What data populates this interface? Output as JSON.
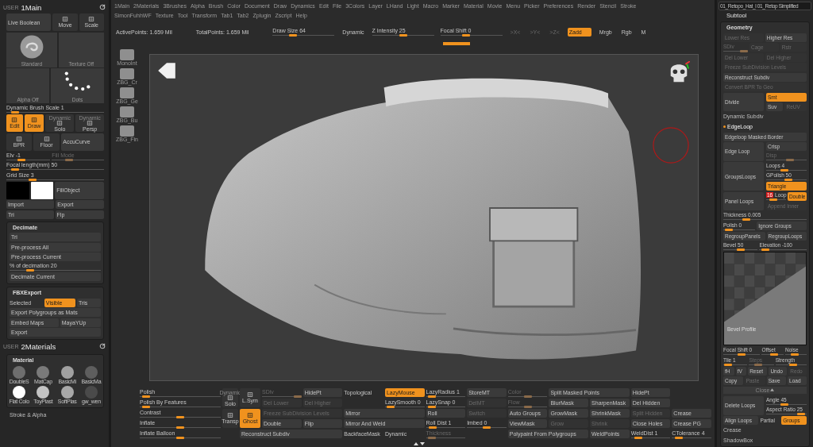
{
  "left_panel": {
    "sections": [
      {
        "kind": "tab",
        "user": "USER",
        "title": "1Main"
      },
      {
        "kind": "rows",
        "rows": [
          {
            "items": [
              {
                "kind": "button",
                "label": "Live Boolean",
                "on": false,
                "disabled": false
              },
              {
                "kind": "icon",
                "label": "Move",
                "on": false
              },
              {
                "kind": "icon",
                "label": "Scale",
                "on": false
              }
            ]
          },
          {
            "items": [
              {
                "kind": "brush",
                "label": "Standard"
              },
              {
                "kind": "texture",
                "label": "Texture Off"
              }
            ]
          },
          {
            "items": [
              {
                "kind": "alpha",
                "label": "Alpha Off"
              },
              {
                "kind": "stroke",
                "label": "Dots"
              }
            ]
          },
          {
            "items": [
              {
                "kind": "slider",
                "label": "Dynamic Brush Scale",
                "value": "1",
                "level": 0.05,
                "disabled": false
              }
            ]
          },
          {
            "items": [
              {
                "kind": "icon",
                "label": "Edit",
                "on": true
              },
              {
                "kind": "icon",
                "label": "Draw",
                "on": true
              },
              {
                "kind": "icon",
                "caption": "Dynamic",
                "label": "Solo",
                "on": false
              },
              {
                "kind": "icon",
                "caption": "Dynamic",
                "label": "Persp",
                "on": false
              }
            ]
          },
          {
            "items": [
              {
                "kind": "icon",
                "label": "BPR",
                "on": false
              },
              {
                "kind": "icon",
                "label": "Floor",
                "on": false
              },
              {
                "kind": "button",
                "label": "AccuCurve",
                "on": false,
                "disabled": false
              }
            ]
          },
          {
            "items": [
              {
                "kind": "slider",
                "label": "Elv",
                "value": "-1",
                "level": 0.3,
                "disabled": false
              },
              {
                "kind": "slider",
                "label": "Fill Mode",
                "level": 0.3,
                "disabled": true
              }
            ]
          },
          {
            "items": [
              {
                "kind": "slider",
                "label": "Focal length(mm)",
                "value": "50",
                "level": 0.05,
                "disabled": false
              }
            ]
          },
          {
            "items": [
              {
                "kind": "slider",
                "label": "Grid Size",
                "value": "3",
                "level": 0.25,
                "disabled": false
              }
            ]
          },
          {
            "items": [
              {
                "kind": "swatch",
                "color": "#000000"
              },
              {
                "kind": "swatch",
                "color": "#ffffff"
              },
              {
                "kind": "button",
                "label": "FillObject",
                "on": false,
                "disabled": false
              }
            ]
          },
          {
            "items": [
              {
                "kind": "button",
                "label": "Import",
                "on": false,
                "disabled": false
              },
              {
                "kind": "button",
                "label": "Export",
                "on": false,
                "disabled": false
              }
            ]
          },
          {
            "items": [
              {
                "kind": "button",
                "label": "Tri",
                "on": false,
                "disabled": false
              },
              {
                "kind": "button",
                "label": "Flp",
                "on": false,
                "disabled": false
              }
            ]
          }
        ]
      },
      {
        "kind": "panel",
        "title": "Decimate",
        "rows": [
          {
            "items": [
              {
                "kind": "button",
                "label": "Tri",
                "on": false,
                "disabled": false
              }
            ]
          },
          {
            "items": [
              {
                "kind": "button",
                "label": "Pre-process All",
                "on": false,
                "disabled": false
              }
            ]
          },
          {
            "items": [
              {
                "kind": "button",
                "label": "Pre-process Current",
                "on": false,
                "disabled": false
              }
            ]
          },
          {
            "items": [
              {
                "kind": "slider",
                "label": "% of decimation",
                "value": "20",
                "level": 0.2,
                "disabled": false
              }
            ]
          },
          {
            "items": [
              {
                "kind": "button",
                "label": "Decimate Current",
                "on": false,
                "disabled": false
              }
            ]
          }
        ]
      },
      {
        "kind": "panel",
        "title": "FBXExport",
        "rows": [
          {
            "items": [
              {
                "kind": "text",
                "label": "Selected"
              },
              {
                "kind": "button",
                "label": "Visible",
                "on": true,
                "disabled": false
              },
              {
                "kind": "button",
                "label": "Tris",
                "on": false,
                "disabled": false
              }
            ]
          },
          {
            "items": [
              {
                "kind": "button",
                "label": "Export Polygroups as Mats",
                "on": false,
                "disabled": false
              }
            ]
          },
          {
            "items": [
              {
                "kind": "button",
                "label": "Embed Maps",
                "on": false,
                "disabled": false
              },
              {
                "kind": "button",
                "label": "MayaYUp",
                "on": false,
                "disabled": false
              }
            ]
          },
          {
            "items": [
              {
                "kind": "button",
                "label": "Export",
                "on": false,
                "disabled": false
              }
            ]
          }
        ]
      },
      {
        "kind": "tab",
        "user": "USER",
        "title": "2Materials"
      },
      {
        "kind": "materials",
        "title": "Material",
        "items": [
          {
            "label": "DoubleS",
            "color": "#6e6e6e"
          },
          {
            "label": "MatCap",
            "color": "#7a7a7a"
          },
          {
            "label": "BasicMi",
            "color": "#a0a0a0"
          },
          {
            "label": "BasicMa",
            "color": "#5e5e5e"
          },
          {
            "label": "Flat Colo",
            "color": "#ffffff"
          },
          {
            "label": "ToyPlast",
            "color": "#c4c4c4"
          },
          {
            "label": "SoftPlas",
            "color": "#a8a8a8"
          },
          {
            "label": "gw_wen",
            "color": "#4a4a4a"
          }
        ]
      },
      {
        "kind": "header",
        "label": "Stroke & Alpha",
        "expanded": false
      }
    ]
  },
  "menu": {
    "rows": [
      [
        "1Main",
        "2Materials",
        "3Brushes",
        "Alpha",
        "Brush",
        "Color",
        "Document",
        "Draw",
        "Dynamics",
        "Edit",
        "File",
        "3Colors",
        "Layer",
        "LHand",
        "Light",
        "Macro",
        "Marker",
        "Material",
        "Movie",
        "Menu",
        "Picker",
        "Preferences",
        "Render",
        "Stencil",
        "Stroke"
      ],
      [
        "SimonFuhhWF",
        "Texture",
        "Tool",
        "Transform",
        "Tab1",
        "Tab2",
        "Zplugin",
        "Zscript",
        "Help"
      ]
    ]
  },
  "toolbar": {
    "items": [
      {
        "kind": "text",
        "label": "ActivePoints: 1.659 Mil"
      },
      {
        "kind": "text",
        "label": "TotalPoints: 1.659 Mil"
      },
      {
        "kind": "slider",
        "label": "Draw Size",
        "value": "64",
        "level": 0.3,
        "disabled": false
      },
      {
        "kind": "button",
        "label": "Dynamic",
        "on": false,
        "disabled": false
      },
      {
        "kind": "slider",
        "label": "Z Intensity",
        "value": "25",
        "level": 0.5,
        "disabled": false
      },
      {
        "kind": "slider",
        "label": "Focal Shift",
        "value": "0",
        "level": 0.4,
        "disabled": false
      },
      {
        "kind": "button",
        "label": ">X<",
        "on": false,
        "disabled": true
      },
      {
        "kind": "button",
        "label": ">Y<",
        "on": false,
        "disabled": true
      },
      {
        "kind": "button",
        "label": ">Z<",
        "on": false,
        "disabled": true
      },
      {
        "kind": "button",
        "label": "Zadd",
        "on": true,
        "disabled": false
      },
      {
        "kind": "button",
        "label": "Mrgb",
        "on": false,
        "disabled": false
      },
      {
        "kind": "button",
        "label": "Rgb",
        "on": false,
        "disabled": false
      },
      {
        "kind": "button",
        "label": "M",
        "on": false,
        "disabled": false
      }
    ]
  },
  "tool_shelf": {
    "items": [
      "MonoInt",
      "ZBG_Cr",
      "ZBG_Ge",
      "ZBG_Bu",
      "ZBG_Fin"
    ]
  },
  "bottom_shelf": {
    "rows": [
      [
        {
          "kind": "slider",
          "label": "Polish",
          "level": 0.03,
          "disabled": false
        },
        {
          "kind": "icon",
          "caption": "Dynamic",
          "label": "Solo",
          "on": false
        },
        {
          "kind": "icon",
          "label": "L.Sym",
          "on": false
        },
        {
          "kind": "slider",
          "label": "SDiv",
          "level": 1,
          "disabled": true
        },
        {
          "kind": "button",
          "label": "HidePt",
          "on": false,
          "disabled": false
        },
        {
          "kind": "text",
          "label": "Topological"
        },
        {
          "kind": "button",
          "label": "LazyMouse",
          "on": true,
          "disabled": false
        },
        {
          "kind": "slider",
          "label": "LazyRadius",
          "value": "1",
          "level": 0.05,
          "disabled": false
        },
        {
          "kind": "button",
          "label": "StoreMT",
          "on": false,
          "disabled": false
        },
        {
          "kind": "slider",
          "label": "Color",
          "level": 0.5,
          "disabled": true
        },
        {
          "kind": "button",
          "label": "Split Masked Points",
          "on": false,
          "disabled": false
        },
        "",
        {
          "kind": "button",
          "label": "HidePt",
          "on": false,
          "disabled": false
        }
      ],
      [
        {
          "kind": "slider",
          "label": "Polish By Features",
          "level": 0.03,
          "disabled": false
        },
        "",
        "",
        {
          "kind": "button",
          "label": "Del Lower",
          "on": false,
          "disabled": true
        },
        {
          "kind": "button",
          "label": "Del Higher",
          "on": false,
          "disabled": true
        },
        "",
        {
          "kind": "slider",
          "label": "LazySmooth",
          "value": "0",
          "level": 0.05,
          "disabled": false
        },
        {
          "kind": "slider",
          "label": "LazySnap",
          "value": "0",
          "level": 0.05,
          "disabled": false
        },
        {
          "kind": "button",
          "label": "DelMT",
          "on": false,
          "disabled": true
        },
        {
          "kind": "slider",
          "label": "Flow",
          "level": 0.5,
          "disabled": true
        },
        {
          "kind": "button",
          "label": "BlurMask",
          "on": false,
          "disabled": false
        },
        {
          "kind": "button",
          "label": "SharpenMask",
          "on": false,
          "disabled": false
        },
        {
          "kind": "button",
          "label": "Del Hidden",
          "on": false,
          "disabled": false
        }
      ],
      [
        {
          "kind": "slider",
          "label": "Contrast",
          "level": 0.5,
          "disabled": false
        },
        {
          "kind": "icon",
          "label": "Transp",
          "on": false
        },
        {
          "kind": "icon",
          "label": "Ghost",
          "on": true
        },
        {
          "kind": "button",
          "label": "Freeze SubDivision Levels",
          "on": false,
          "disabled": true
        },
        "",
        {
          "kind": "button",
          "label": "Mirror",
          "on": false,
          "disabled": false
        },
        "",
        {
          "kind": "button",
          "label": "Roll",
          "on": false,
          "disabled": false
        },
        {
          "kind": "button",
          "label": "Switch",
          "on": false,
          "disabled": true
        },
        {
          "kind": "button",
          "label": "Auto Groups",
          "on": false,
          "disabled": false
        },
        {
          "kind": "button",
          "label": "GrowMask",
          "on": false,
          "disabled": false
        },
        {
          "kind": "button",
          "label": "ShrinkMask",
          "on": false,
          "disabled": false
        },
        {
          "kind": "button",
          "label": "Split Hidden",
          "on": false,
          "disabled": true
        },
        {
          "kind": "button",
          "label": "Crease",
          "on": false,
          "disabled": false
        }
      ],
      [
        {
          "kind": "slider",
          "label": "Inflate",
          "level": 0.5,
          "disabled": false
        },
        "",
        "",
        {
          "kind": "button",
          "label": "Double",
          "on": false,
          "disabled": false
        },
        {
          "kind": "button",
          "label": "Flip",
          "on": false,
          "disabled": false
        },
        {
          "kind": "button",
          "label": "Mirror And Weld",
          "on": false,
          "disabled": false
        },
        "",
        {
          "kind": "slider",
          "label": "Roll Dist",
          "value": "1",
          "level": 0.1,
          "disabled": false
        },
        {
          "kind": "slider",
          "label": "Imbed",
          "value": "0",
          "level": 0.5,
          "disabled": false
        },
        {
          "kind": "button",
          "label": "ViewMask",
          "on": false,
          "disabled": false
        },
        {
          "kind": "button",
          "label": "Grow",
          "on": false,
          "disabled": true
        },
        {
          "kind": "button",
          "label": "Shrink",
          "on": false,
          "disabled": true
        },
        {
          "kind": "button",
          "label": "Close Holes",
          "on": false,
          "disabled": false
        },
        {
          "kind": "button",
          "label": "Crease PG",
          "on": false,
          "disabled": false
        }
      ],
      [
        {
          "kind": "slider",
          "label": "Inflate Balloon",
          "level": 0.5,
          "disabled": false
        },
        "",
        {
          "kind": "button",
          "label": "Reconstruct Subdiv",
          "on": false,
          "disabled": false
        },
        "",
        "",
        {
          "kind": "text",
          "label": "BackfaceMask"
        },
        {
          "kind": "text",
          "label": "Dynamic"
        },
        {
          "kind": "slider",
          "label": "Thickness",
          "level": 0.05,
          "disabled": true
        },
        "",
        {
          "kind": "button",
          "label": "Polypaint From Polygroups",
          "on": false,
          "disabled": false
        },
        "",
        {
          "kind": "button",
          "label": "WeldPoints",
          "on": false,
          "disabled": false
        },
        {
          "kind": "slider",
          "label": "WeldDist",
          "value": "1",
          "level": 0.1,
          "disabled": false
        },
        {
          "kind": "slider",
          "label": "CTolerance",
          "value": "4",
          "level": 0.1,
          "disabled": false
        }
      ]
    ]
  },
  "right_panel": {
    "file_field": "01_Retopo_Hat_l 01_Retop Simplified",
    "subtool": "Subtool",
    "title": "Geometry",
    "rows": [
      {
        "items": [
          {
            "kind": "button",
            "label": "Lower Res",
            "on": false,
            "disabled": true
          },
          {
            "kind": "button",
            "label": "Higher Res",
            "on": false,
            "disabled": false
          }
        ]
      },
      {
        "items": [
          {
            "kind": "slider",
            "label": "SDiv",
            "level": 1,
            "disabled": true
          },
          {
            "kind": "button",
            "label": "Cage",
            "on": false,
            "disabled": true
          },
          {
            "kind": "button",
            "label": "Rstr",
            "on": false,
            "disabled": true
          }
        ]
      },
      {
        "items": [
          {
            "kind": "button",
            "label": "Del Lower",
            "on": false,
            "disabled": true
          },
          {
            "kind": "button",
            "label": "Del Higher",
            "on": false,
            "disabled": true
          }
        ]
      },
      {
        "items": [
          {
            "kind": "button",
            "label": "Freeze SubDivision Levels",
            "on": false,
            "disabled": true
          }
        ]
      },
      {
        "items": [
          {
            "kind": "button",
            "label": "Reconstruct Subdiv",
            "on": false,
            "disabled": false
          }
        ]
      },
      {
        "items": [
          {
            "kind": "button",
            "label": "Convert BPR To Geo",
            "on": false,
            "disabled": true
          }
        ]
      },
      {
        "side": {
          "kind": "button",
          "label": "Divide",
          "on": false,
          "disabled": false
        },
        "stack": [
          [
            {
              "kind": "button",
              "label": "Smt",
              "on": true,
              "disabled": false
            }
          ],
          [
            {
              "kind": "button",
              "label": "Suv",
              "on": false,
              "disabled": false
            },
            {
              "kind": "button",
              "label": "ReUV",
              "on": false,
              "disabled": true
            }
          ]
        ]
      },
      {
        "items": [
          {
            "kind": "header",
            "label": "Dynamic Subdiv",
            "expanded": false
          }
        ]
      },
      {
        "items": [
          {
            "kind": "header",
            "label": "EdgeLoop",
            "expanded": true
          }
        ]
      },
      {
        "items": [
          {
            "kind": "button",
            "label": "Edgeloop Masked Border",
            "on": false,
            "disabled": false
          }
        ]
      },
      {
        "side": {
          "kind": "button",
          "label": "Edge Loop",
          "on": false,
          "disabled": false
        },
        "stack": [
          [
            {
              "kind": "button",
              "label": "Crisp",
              "on": false,
              "disabled": false
            }
          ],
          [
            {
              "kind": "slider",
              "label": "Disp",
              "level": 0.6,
              "disabled": true
            }
          ]
        ]
      },
      {
        "side": {
          "kind": "button",
          "label": "GroupsLoops",
          "on": false,
          "disabled": false
        },
        "stack": [
          [
            {
              "kind": "slider",
              "label": "Loops",
              "value": "4",
              "level": 0.45,
              "disabled": false
            }
          ],
          [
            {
              "kind": "slider",
              "label": "GPolish",
              "value": "50",
              "level": 0.55,
              "disabled": false
            }
          ],
          [
            {
              "kind": "button",
              "label": "Triangle",
              "on": true,
              "disabled": false
            }
          ]
        ]
      },
      {
        "side": {
          "kind": "button",
          "label": "Panel Loops",
          "on": false,
          "disabled": false
        },
        "stack": [
          [
            {
              "kind": "badge_slider",
              "badge": "16",
              "label": "Loop",
              "level": 0.3,
              "disabled": false
            },
            {
              "kind": "button",
              "label": "Double",
              "on": true,
              "disabled": false
            }
          ],
          [
            {
              "kind": "button",
              "label": "Append Inner",
              "on": false,
              "disabled": true
            }
          ]
        ]
      },
      {
        "items": [
          {
            "kind": "slider",
            "label": "Thickness",
            "value": "0.005",
            "level": 0.25,
            "disabled": false
          }
        ]
      },
      {
        "items": [
          {
            "kind": "slider",
            "label": "Polish",
            "value": "0",
            "level": 0.05,
            "disabled": false
          },
          {
            "kind": "button",
            "label": "Ignore Groups",
            "on": false,
            "disabled": false
          }
        ]
      },
      {
        "items": [
          {
            "kind": "button",
            "label": "RegroupPanels",
            "on": false,
            "disabled": false
          },
          {
            "kind": "button",
            "label": "RegroupLoops",
            "on": false,
            "disabled": false
          }
        ]
      },
      {
        "items": [
          {
            "kind": "slider",
            "label": "Bevel",
            "value": "50",
            "level": 0.5,
            "disabled": false
          },
          {
            "kind": "slider",
            "label": "Elevation",
            "value": "-100",
            "level": 0.05,
            "disabled": false
          }
        ]
      },
      {
        "items": [
          {
            "kind": "curve",
            "label": "Bevel Profile"
          }
        ]
      },
      {
        "items": [
          {
            "kind": "slider",
            "label": "Focal Shift",
            "value": "0",
            "level": 0.5,
            "disabled": false
          },
          {
            "kind": "slider",
            "label": "Offset",
            "level": 0.6,
            "disabled": false
          },
          {
            "kind": "slider",
            "label": "Noise",
            "level": 0.4,
            "disabled": false
          }
        ]
      },
      {
        "items": [
          {
            "kind": "slider",
            "label": "Tile",
            "value": "1",
            "level": 0.05,
            "disabled": false
          },
          {
            "kind": "slider",
            "label": "Steps",
            "level": 0.3,
            "disabled": true
          },
          {
            "kind": "slider",
            "label": "Strength",
            "level": 0.6,
            "disabled": false
          }
        ]
      },
      {
        "items": [
          {
            "kind": "button",
            "label": "fH",
            "on": false,
            "disabled": false
          },
          {
            "kind": "button",
            "label": "fV",
            "on": false,
            "disabled": false
          },
          {
            "kind": "button",
            "label": "Reset",
            "on": false,
            "disabled": false
          },
          {
            "kind": "button",
            "label": "Undo",
            "on": false,
            "disabled": false
          },
          {
            "kind": "button",
            "label": "Redo",
            "on": false,
            "disabled": true
          }
        ]
      },
      {
        "items": [
          {
            "kind": "button",
            "label": "Copy",
            "on": false,
            "disabled": false
          },
          {
            "kind": "button",
            "label": "Paste",
            "on": false,
            "disabled": true
          },
          {
            "kind": "button",
            "label": "Save",
            "on": false,
            "disabled": false
          },
          {
            "kind": "button",
            "label": "Load",
            "on": false,
            "disabled": false
          }
        ]
      },
      {
        "items": [
          {
            "kind": "closebar",
            "label": "Close"
          }
        ]
      },
      {
        "side": {
          "kind": "button",
          "label": "Delete Loops",
          "on": false,
          "disabled": false
        },
        "stack": [
          [
            {
              "kind": "slider",
              "label": "Angle",
              "value": "45",
              "level": 0.45,
              "disabled": false
            }
          ],
          [
            {
              "kind": "slider",
              "label": "Aspect Ratio",
              "value": "25",
              "level": 0.95,
              "disabled": false
            }
          ]
        ]
      },
      {
        "items": [
          {
            "kind": "button",
            "label": "Align Loops",
            "on": false,
            "disabled": false
          },
          {
            "kind": "text",
            "label": "Partial"
          },
          {
            "kind": "button",
            "label": "Groups",
            "on": true,
            "disabled": false
          }
        ]
      },
      {
        "items": [
          {
            "kind": "header",
            "label": "Crease",
            "expanded": false
          }
        ]
      },
      {
        "items": [
          {
            "kind": "header",
            "label": "ShadowBox",
            "expanded": false
          }
        ]
      }
    ]
  }
}
